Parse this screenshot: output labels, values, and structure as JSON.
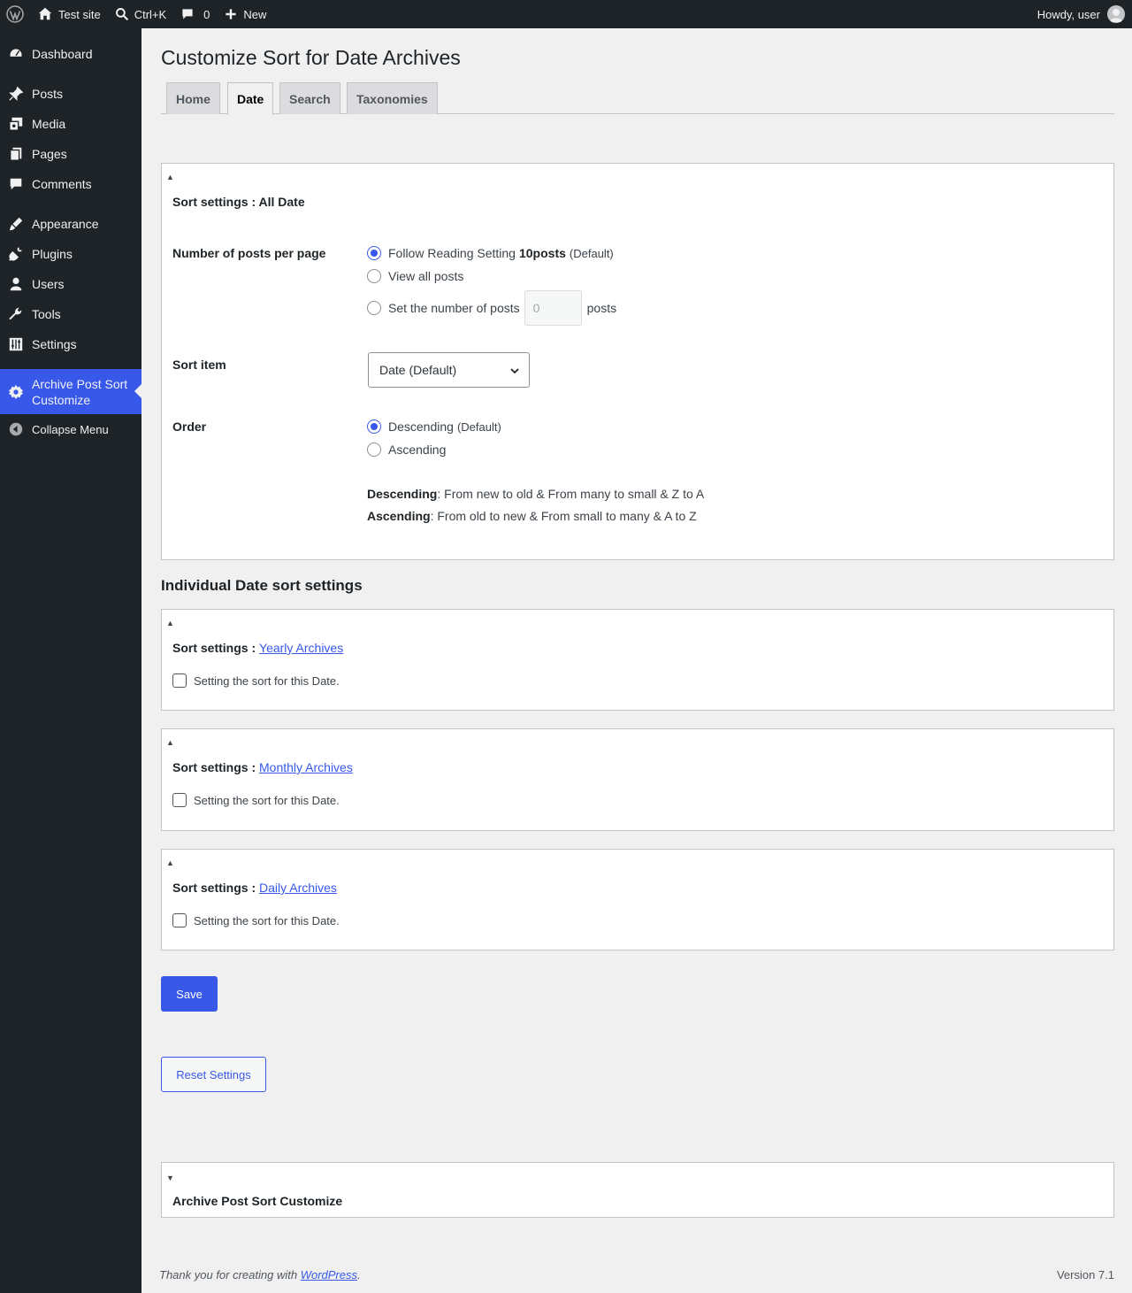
{
  "admin_bar": {
    "site_name": "Test site",
    "search_shortcut": "Ctrl+K",
    "comments_count": "0",
    "new_label": "New",
    "greeting": "Howdy, user"
  },
  "sidebar": {
    "items": [
      {
        "label": "Dashboard",
        "icon": "dashboard-icon"
      },
      {
        "label": "Posts",
        "icon": "pin-icon"
      },
      {
        "label": "Media",
        "icon": "media-icon"
      },
      {
        "label": "Pages",
        "icon": "pages-icon"
      },
      {
        "label": "Comments",
        "icon": "comment-icon"
      },
      {
        "label": "Appearance",
        "icon": "brush-icon"
      },
      {
        "label": "Plugins",
        "icon": "plug-icon"
      },
      {
        "label": "Users",
        "icon": "user-icon"
      },
      {
        "label": "Tools",
        "icon": "wrench-icon"
      },
      {
        "label": "Settings",
        "icon": "sliders-icon"
      },
      {
        "label_line1": "Archive Post Sort",
        "label_line2": "Customize",
        "icon": "gear-icon"
      },
      {
        "label": "Collapse Menu",
        "icon": "collapse-icon"
      }
    ]
  },
  "page": {
    "title": "Customize Sort for Date Archives",
    "tabs": [
      "Home",
      "Date",
      "Search",
      "Taxonomies"
    ],
    "active_tab": "Date"
  },
  "all_date": {
    "title": "Sort settings : All Date",
    "posts_per_page": {
      "label": "Number of posts per page",
      "option_follow": "Follow Reading Setting",
      "follow_value": "10posts",
      "default_tag": "(Default)",
      "option_all": "View all posts",
      "option_set": "Set the number of posts",
      "set_value": "0",
      "set_suffix": "posts",
      "selected": "follow"
    },
    "sort_item": {
      "label": "Sort item",
      "value": "Date (Default)"
    },
    "order": {
      "label": "Order",
      "option_desc": "Descending",
      "default_tag": "(Default)",
      "option_asc": "Ascending",
      "selected": "desc",
      "desc_term": "Descending",
      "desc_text": ": From new to old & From many to small & Z to A",
      "asc_term": "Ascending",
      "asc_text": ": From old to new & From small to many & A to Z"
    }
  },
  "individual": {
    "heading": "Individual Date sort settings",
    "prefix": "Sort settings :",
    "checkbox_label": "Setting the sort for this Date.",
    "boxes": [
      {
        "link": "Yearly Archives",
        "checked": false
      },
      {
        "link": "Monthly Archives",
        "checked": false
      },
      {
        "link": "Daily Archives",
        "checked": false
      }
    ]
  },
  "buttons": {
    "save": "Save",
    "reset": "Reset Settings"
  },
  "about_box": {
    "title": "Archive Post Sort Customize"
  },
  "footer": {
    "thanks_prefix": "Thank you for creating with ",
    "thanks_link": "WordPress",
    "thanks_suffix": ".",
    "version": "Version 7.1"
  },
  "colors": {
    "accent": "#3858e9",
    "admin_bar_bg": "#1d2327",
    "page_bg": "#f0f0f1"
  }
}
